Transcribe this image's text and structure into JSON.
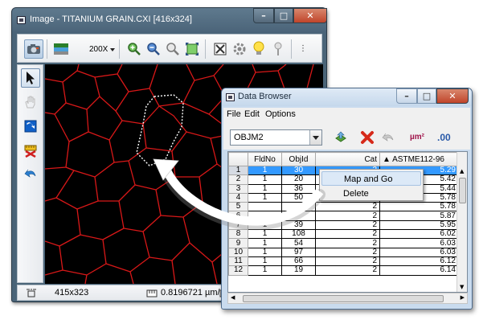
{
  "image_window": {
    "title": "Image - TITANIUM GRAIN.CXI [416x324]",
    "zoom": "200X",
    "status_size": "415x323",
    "status_scale": "0.8196721 µm/pixel"
  },
  "data_browser": {
    "title": "Data Browser",
    "menu": [
      "File",
      "Edit",
      "Options"
    ],
    "object_selector": "OBJM2",
    "units_label": "µm²",
    "decimals_label": ".00",
    "columns": [
      "FldNo",
      "ObjId",
      "Cat",
      "▲ ASTME112-96"
    ],
    "rows": [
      {
        "row": "1",
        "fld": "1",
        "obj": "30",
        "cat": "2",
        "astm": "5.29"
      },
      {
        "row": "2",
        "fld": "1",
        "obj": "20",
        "cat": "2",
        "astm": "5.42"
      },
      {
        "row": "3",
        "fld": "1",
        "obj": "36",
        "cat": "2",
        "astm": "5.44"
      },
      {
        "row": "4",
        "fld": "1",
        "obj": "50",
        "cat": "2",
        "astm": "5.78"
      },
      {
        "row": "5",
        "fld": "",
        "obj": "",
        "cat": "2",
        "astm": "5.78"
      },
      {
        "row": "6",
        "fld": "",
        "obj": "",
        "cat": "2",
        "astm": "5.87"
      },
      {
        "row": "7",
        "fld": "1",
        "obj": "39",
        "cat": "2",
        "astm": "5.95"
      },
      {
        "row": "8",
        "fld": "1",
        "obj": "108",
        "cat": "2",
        "astm": "6.02"
      },
      {
        "row": "9",
        "fld": "1",
        "obj": "54",
        "cat": "2",
        "astm": "6.03"
      },
      {
        "row": "10",
        "fld": "1",
        "obj": "97",
        "cat": "2",
        "astm": "6.03"
      },
      {
        "row": "11",
        "fld": "1",
        "obj": "66",
        "cat": "2",
        "astm": "6.12"
      },
      {
        "row": "12",
        "fld": "1",
        "obj": "19",
        "cat": "2",
        "astm": "6.14"
      }
    ],
    "context_menu": [
      "Map and Go",
      "Delete"
    ]
  },
  "icons": [
    "camera-icon",
    "color-depth-icon",
    "zoom-in-icon",
    "zoom-out-icon",
    "zoom-fit-icon",
    "fit-window-icon",
    "crop-icon",
    "settings-icon",
    "bulb-icon",
    "pin-icon",
    "pointer-icon",
    "hand-icon",
    "map-icon",
    "measure-icon",
    "undo-icon"
  ],
  "colors": {
    "grain_boundary": "#d81818",
    "selection": "#3399ff",
    "close_button": "#c8452c"
  }
}
